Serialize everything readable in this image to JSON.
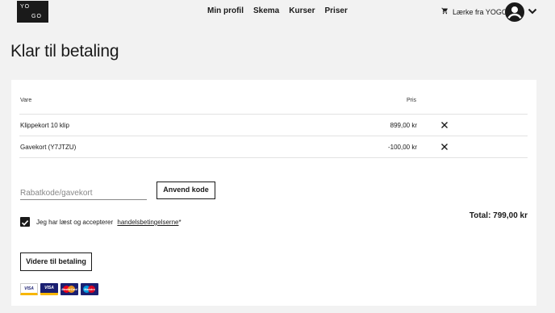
{
  "header": {
    "logo_top": "YO",
    "logo_bottom": "GO",
    "nav": [
      "Min profil",
      "Skema",
      "Kurser",
      "Priser"
    ],
    "user_label": "Lærke fra YOGO"
  },
  "page": {
    "title": "Klar til betaling"
  },
  "cart": {
    "col_item": "Vare",
    "col_price": "Pris",
    "items": [
      {
        "name": "Klippekort 10 klip",
        "price": "899,00 kr"
      },
      {
        "name": "Gavekort (Y7JTZU)",
        "price": "-100,00 kr"
      }
    ]
  },
  "discount": {
    "placeholder": "Rabatkode/gavekort",
    "value": "",
    "apply_label": "Anvend kode"
  },
  "terms": {
    "checked": true,
    "prefix": "Jeg har læst og accepterer",
    "link": "handelsbetingelserne",
    "required_mark": "*"
  },
  "total": "Total: 799,00 kr",
  "continue_label": "Videre til betaling",
  "payment_methods": [
    "VISA",
    "VISA",
    "MasterCard",
    "Maestro"
  ],
  "colors": {
    "text": "#1a1a1a",
    "background": "#f2f2f2",
    "card": "#ffffff"
  }
}
